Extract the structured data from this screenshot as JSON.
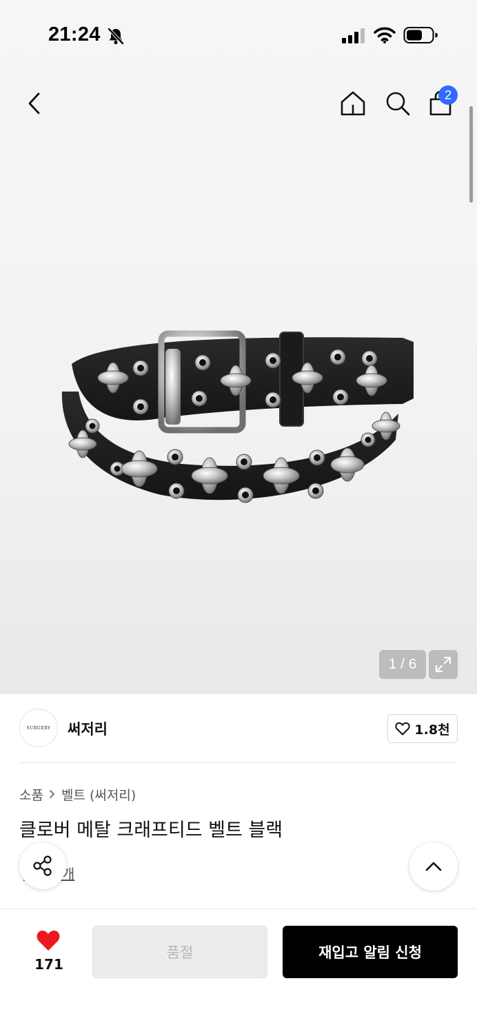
{
  "status_bar": {
    "time": "21:24"
  },
  "header": {
    "cart_count": "2"
  },
  "gallery": {
    "pager": "1 / 6"
  },
  "brand": {
    "logo_text": "SURGERY",
    "name": "써저리",
    "likes": "1.8천"
  },
  "breadcrumb": {
    "items": [
      "소품",
      "벨트 (써저리)"
    ]
  },
  "product": {
    "title": "클로버 메탈 크래프티드 벨트 블랙",
    "review_link": "후기 3개"
  },
  "bottom_bar": {
    "wish_count": "171",
    "soldout_label": "품절",
    "restock_label": "재입고 알림 신청"
  },
  "colors": {
    "accent_blue": "#2f6bff",
    "heart_red": "#f0161d",
    "primary_black": "#000000"
  },
  "icons": [
    "bell-slash-icon",
    "signal-icon",
    "wifi-icon",
    "battery-icon",
    "back-arrow-icon",
    "home-icon",
    "search-icon",
    "shopping-bag-icon",
    "expand-icon",
    "heart-outline-icon",
    "chevron-right-icon",
    "share-icon",
    "chevron-up-icon",
    "heart-filled-icon"
  ]
}
